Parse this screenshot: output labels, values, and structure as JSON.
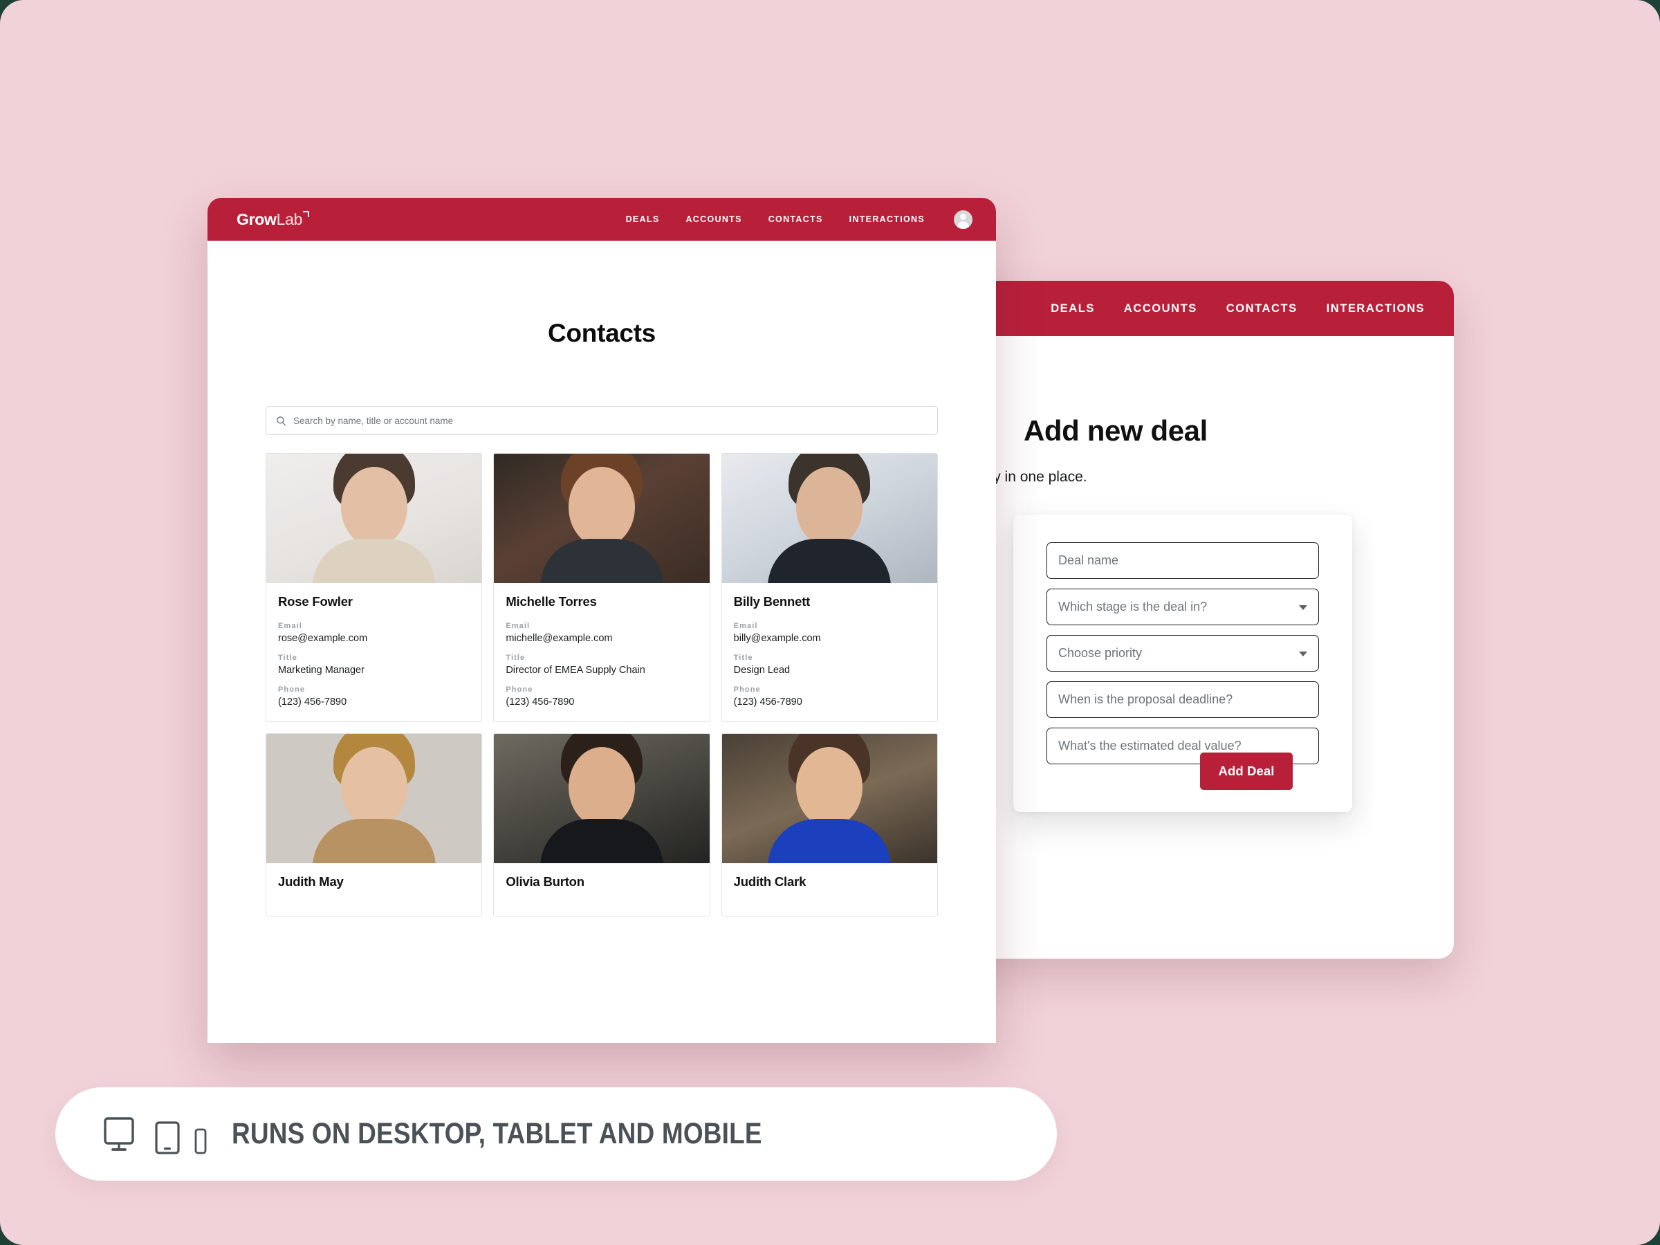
{
  "brand": {
    "accent": "#b8203a",
    "page_bg": "#f1d2d8",
    "logo_grow": "Grow",
    "logo_lab": "Lab"
  },
  "contacts_window": {
    "nav": [
      {
        "label": "DEALS"
      },
      {
        "label": "ACCOUNTS"
      },
      {
        "label": "CONTACTS"
      },
      {
        "label": "INTERACTIONS"
      }
    ],
    "avatar_icon": "user-avatar-icon",
    "page_title": "Contacts",
    "search": {
      "icon": "search-icon",
      "placeholder": "Search by name, title or account name",
      "value": ""
    },
    "field_labels": {
      "email": "Email",
      "title": "Title",
      "phone": "Phone"
    },
    "contacts": [
      {
        "name": "Rose Fowler",
        "email": "rose@example.com",
        "title": "Marketing Manager",
        "phone": "(123) 456-7890"
      },
      {
        "name": "Michelle Torres",
        "email": "michelle@example.com",
        "title": "Director of EMEA Supply Chain",
        "phone": "(123) 456-7890"
      },
      {
        "name": "Billy Bennett",
        "email": "billy@example.com",
        "title": "Design Lead",
        "phone": "(123) 456-7890"
      },
      {
        "name": "Judith May"
      },
      {
        "name": "Olivia Burton"
      },
      {
        "name": "Judith Clark"
      }
    ]
  },
  "deal_window": {
    "nav": [
      {
        "label": "DEALS"
      },
      {
        "label": "ACCOUNTS"
      },
      {
        "label": "CONTACTS"
      },
      {
        "label": "INTERACTIONS"
      }
    ],
    "title": "Add new deal",
    "subtitle": "deals and keep track of all the history in one place.",
    "form": {
      "deal_name_placeholder": "Deal name",
      "stage_placeholder": "Which stage is the deal in?",
      "priority_placeholder": "Choose priority",
      "deadline_placeholder": "When is the proposal deadline?",
      "value_placeholder": "What's the estimated deal value?",
      "submit_label": "Add Deal"
    }
  },
  "banner": {
    "text": "RUNS ON DESKTOP, TABLET AND MOBILE",
    "icons": [
      "desktop-icon",
      "tablet-icon",
      "mobile-icon"
    ]
  }
}
